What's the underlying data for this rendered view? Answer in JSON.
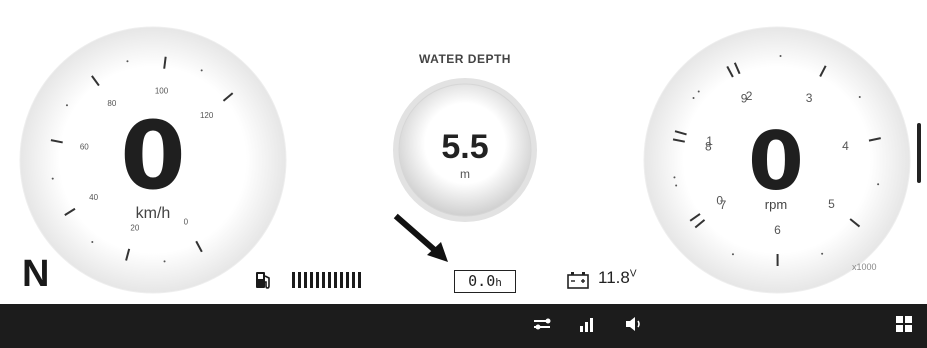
{
  "speedometer": {
    "value": "0",
    "unit": "km/h",
    "ticks": [
      "0",
      "20",
      "40",
      "60",
      "80",
      "100",
      "120"
    ]
  },
  "water_depth": {
    "title": "WATER DEPTH",
    "value": "5.5",
    "unit": "m"
  },
  "tachometer": {
    "value": "0",
    "unit": "rpm",
    "multiplier": "x1000",
    "ticks": [
      "0",
      "1",
      "2",
      "3",
      "4",
      "5",
      "6",
      "7",
      "8",
      "9"
    ]
  },
  "status": {
    "gear": "N",
    "fuel_level": 1.0,
    "fuel_bars": 12,
    "engine_hours": "0.0",
    "engine_hours_unit": "h",
    "battery_voltage": "11.8",
    "battery_unit": "V"
  },
  "bottom_bar": {
    "icons": [
      "trim-icon",
      "signal-icon",
      "volume-icon",
      "apps-grid-icon"
    ]
  },
  "colors": {
    "background": "#ffffff",
    "bottom_bar": "#1c1c1c",
    "text": "#222222"
  }
}
